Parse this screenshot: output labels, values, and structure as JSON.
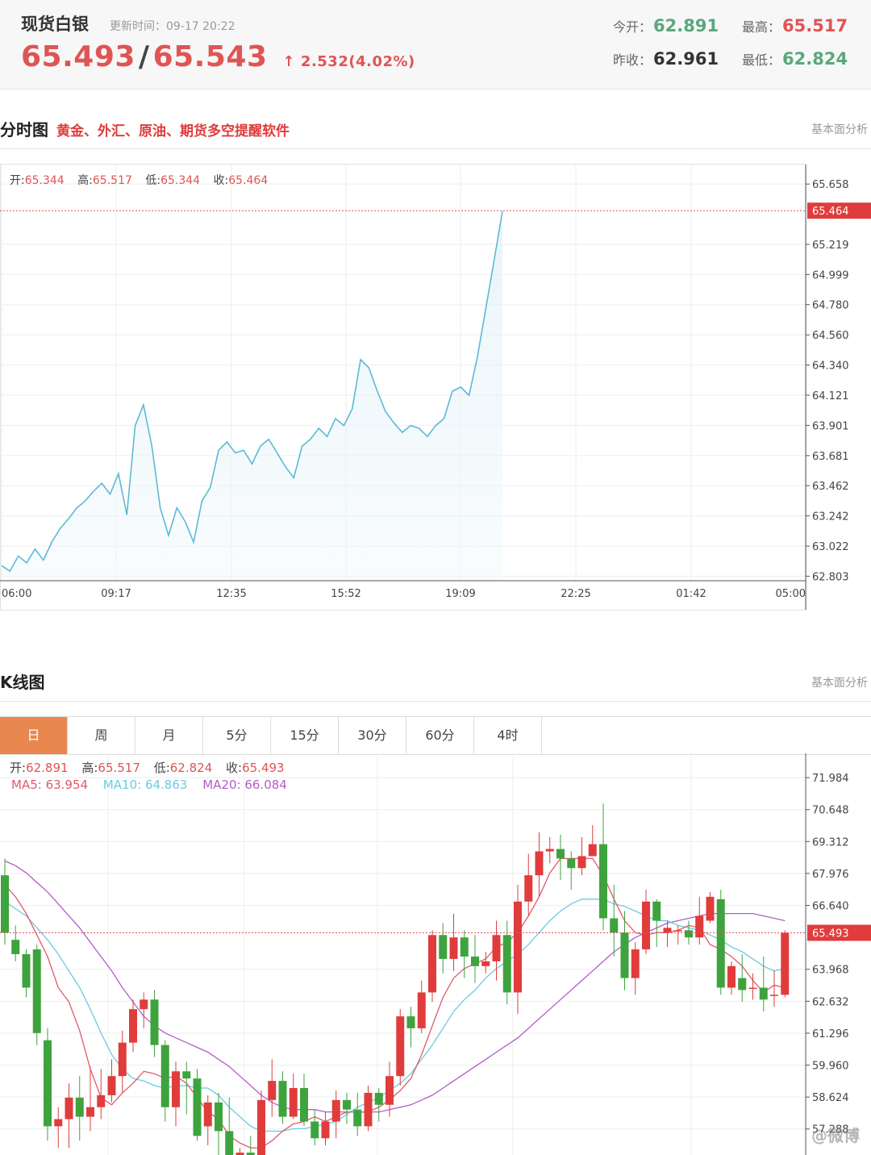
{
  "header": {
    "name": "现货白银",
    "update_time": "更新时间：09-17 20:22",
    "bid": "65.493",
    "ask": "65.543",
    "change": "2.532(4.02%)",
    "open_label": "今开：",
    "open": "62.891",
    "high_label": "最高：",
    "high": "65.517",
    "prev_close_label": "昨收：",
    "prev_close": "62.961",
    "low_label": "最低：",
    "low": "62.824"
  },
  "intraday_section": {
    "title": "分时图",
    "subtitle": "黄金、外汇、原油、期货多空提醒软件",
    "right_link": "基本面分析",
    "ohlc": {
      "o_label": "开:",
      "o": "65.344",
      "h_label": "高:",
      "h": "65.517",
      "l_label": "低:",
      "l": "65.344",
      "c_label": "收:",
      "c": "65.464"
    }
  },
  "kline_section": {
    "title": "K线图",
    "right_link": "基本面分析",
    "tabs": [
      "日",
      "周",
      "月",
      "5分",
      "15分",
      "30分",
      "60分",
      "4时"
    ],
    "active_tab": "日",
    "ohlc": {
      "o_label": "开:",
      "o": "62.891",
      "h_label": "高:",
      "h": "65.517",
      "l_label": "低:",
      "l": "62.824",
      "c_label": "收:",
      "c": "65.493"
    },
    "ma": {
      "ma5": "MA5: 63.954",
      "ma10": "MA10: 64.863",
      "ma20": "MA20: 66.084"
    }
  },
  "watermark": "@微博",
  "colors": {
    "up": "#e03c3c",
    "down": "#3ea33e",
    "line": "#5bbad5",
    "ma5": "#e05a6a",
    "ma10": "#6ccbe0",
    "ma20": "#b45cc8",
    "accent": "#e8874f"
  },
  "chart_data": [
    {
      "type": "line",
      "x_ticks": [
        "06:00",
        "09:17",
        "12:35",
        "15:52",
        "19:09",
        "22:25",
        "01:42",
        "05:00"
      ],
      "y_ticks": [
        "65.658",
        "65.219",
        "64.999",
        "64.780",
        "64.560",
        "64.340",
        "64.121",
        "63.901",
        "63.681",
        "63.462",
        "63.242",
        "63.022",
        "62.803"
      ],
      "ylim": [
        62.77,
        65.8
      ],
      "current_label": "65.464",
      "series": [
        {
          "values": [
            62.88,
            62.84,
            62.95,
            62.9,
            63.0,
            62.92,
            63.05,
            63.15,
            63.22,
            63.3,
            63.35,
            63.42,
            63.48,
            63.4,
            63.55,
            63.25,
            63.9,
            64.05,
            63.75,
            63.3,
            63.1,
            63.3,
            63.2,
            63.05,
            63.35,
            63.45,
            63.72,
            63.78,
            63.7,
            63.72,
            63.62,
            63.75,
            63.8,
            63.7,
            63.6,
            63.52,
            63.75,
            63.8,
            63.88,
            63.82,
            63.95,
            63.9,
            64.02,
            64.38,
            64.32,
            64.15,
            64.0,
            63.92,
            63.85,
            63.9,
            63.88,
            63.82,
            63.9,
            63.95,
            64.15,
            64.18,
            64.12,
            64.4,
            64.75,
            65.1,
            65.46
          ]
        }
      ]
    },
    {
      "type": "candlestick",
      "y_ticks": [
        "71.984",
        "70.648",
        "69.312",
        "67.976",
        "66.640",
        "65.493",
        "63.968",
        "62.632",
        "61.296",
        "59.960",
        "58.624",
        "57.288"
      ],
      "ylim": [
        56.2,
        73.0
      ],
      "current_label": "65.493",
      "candles": [
        [
          67.9,
          65.5,
          68.6,
          65.0
        ],
        [
          65.2,
          64.6,
          65.8,
          64.3
        ],
        [
          64.6,
          63.2,
          64.8,
          62.8
        ],
        [
          64.8,
          61.3,
          65.0,
          60.8
        ],
        [
          61.0,
          57.4,
          61.5,
          56.8
        ],
        [
          57.4,
          57.7,
          58.2,
          56.5
        ],
        [
          57.7,
          58.6,
          59.2,
          56.5
        ],
        [
          58.6,
          57.8,
          59.5,
          56.8
        ],
        [
          57.8,
          58.2,
          59.9,
          57.2
        ],
        [
          58.2,
          58.7,
          59.8,
          57.7
        ],
        [
          58.7,
          59.5,
          60.2,
          58.4
        ],
        [
          59.5,
          60.9,
          61.4,
          58.8
        ],
        [
          60.9,
          62.3,
          62.7,
          60.5
        ],
        [
          62.3,
          62.7,
          63.0,
          61.5
        ],
        [
          62.7,
          60.8,
          63.1,
          60.3
        ],
        [
          60.8,
          58.2,
          61.0,
          57.6
        ],
        [
          58.2,
          59.7,
          60.1,
          57.4
        ],
        [
          59.7,
          59.4,
          60.1,
          57.9
        ],
        [
          59.4,
          57.0,
          59.8,
          56.8
        ],
        [
          57.4,
          58.4,
          58.7,
          56.6
        ],
        [
          58.4,
          57.2,
          58.8,
          56.2
        ],
        [
          57.2,
          55.0,
          58.6,
          54.9
        ],
        [
          55.4,
          56.3,
          56.5,
          55.0
        ],
        [
          56.3,
          55.6,
          57.0,
          55.2
        ],
        [
          55.6,
          58.5,
          58.9,
          55.4
        ],
        [
          58.5,
          59.3,
          60.2,
          57.8
        ],
        [
          59.3,
          57.8,
          59.7,
          57.5
        ],
        [
          57.8,
          59.0,
          59.6,
          57.7
        ],
        [
          59.0,
          57.6,
          59.6,
          57.4
        ],
        [
          57.6,
          56.9,
          58.1,
          56.6
        ],
        [
          56.9,
          57.6,
          58.0,
          56.6
        ],
        [
          57.6,
          58.5,
          58.9,
          56.9
        ],
        [
          58.5,
          58.1,
          58.8,
          57.5
        ],
        [
          58.1,
          57.4,
          58.8,
          57.0
        ],
        [
          57.4,
          58.8,
          59.1,
          57.2
        ],
        [
          58.8,
          58.3,
          59.0,
          57.6
        ],
        [
          58.3,
          59.5,
          60.1,
          57.8
        ],
        [
          59.5,
          62.0,
          62.3,
          59.1
        ],
        [
          62.0,
          61.5,
          62.4,
          60.7
        ],
        [
          61.5,
          63.0,
          63.5,
          61.3
        ],
        [
          63.0,
          65.4,
          65.6,
          62.6
        ],
        [
          65.4,
          64.4,
          65.9,
          63.8
        ],
        [
          64.4,
          65.3,
          66.3,
          63.9
        ],
        [
          65.3,
          64.5,
          65.6,
          63.6
        ],
        [
          64.5,
          64.1,
          65.4,
          63.4
        ],
        [
          64.1,
          64.3,
          64.7,
          63.8
        ],
        [
          64.3,
          65.4,
          66.0,
          63.5
        ],
        [
          65.4,
          63.0,
          66.0,
          62.5
        ],
        [
          63.0,
          66.8,
          67.5,
          62.1
        ],
        [
          66.8,
          67.9,
          68.8,
          66.2
        ],
        [
          67.9,
          68.9,
          69.7,
          67.0
        ],
        [
          68.9,
          69.0,
          69.5,
          68.4
        ],
        [
          69.0,
          68.6,
          69.6,
          67.7
        ],
        [
          68.6,
          68.2,
          68.9,
          67.3
        ],
        [
          68.2,
          68.7,
          69.5,
          67.9
        ],
        [
          68.7,
          69.2,
          70.0,
          68.7
        ],
        [
          69.2,
          66.1,
          70.9,
          65.6
        ],
        [
          66.1,
          65.5,
          67.5,
          64.5
        ],
        [
          65.5,
          63.6,
          66.4,
          63.1
        ],
        [
          63.6,
          64.8,
          65.1,
          62.9
        ],
        [
          64.8,
          66.8,
          67.3,
          64.6
        ],
        [
          66.8,
          66.0,
          66.9,
          64.9
        ],
        [
          65.5,
          65.7,
          66.0,
          64.9
        ],
        [
          65.6,
          65.6,
          65.8,
          65.0
        ],
        [
          65.6,
          65.3,
          66.0,
          65.0
        ],
        [
          65.3,
          66.2,
          67.0,
          65.0
        ],
        [
          66.0,
          67.0,
          67.2,
          65.9
        ],
        [
          66.9,
          63.2,
          67.3,
          62.9
        ],
        [
          63.2,
          64.1,
          64.3,
          62.9
        ],
        [
          63.6,
          63.1,
          64.6,
          62.6
        ],
        [
          63.2,
          63.2,
          63.8,
          62.7
        ],
        [
          63.2,
          62.7,
          64.5,
          62.2
        ],
        [
          62.9,
          62.9,
          63.9,
          62.4
        ],
        [
          62.9,
          65.5,
          65.6,
          62.8
        ]
      ],
      "ma5": [
        67.5,
        67.0,
        66.3,
        65.4,
        64.5,
        63.2,
        62.6,
        61.4,
        59.8,
        58.6,
        58.3,
        58.8,
        59.2,
        59.7,
        59.6,
        59.4,
        59.5,
        59.2,
        58.6,
        58.0,
        57.7,
        57.0,
        56.7,
        56.5,
        56.5,
        56.8,
        57.2,
        57.5,
        57.6,
        57.8,
        57.6,
        57.8,
        58.0,
        58.0,
        58.0,
        58.2,
        58.5,
        58.9,
        59.4,
        60.4,
        61.6,
        62.8,
        63.6,
        64.0,
        64.2,
        64.4,
        64.9,
        65.1,
        65.5,
        66.2,
        67.0,
        68.0,
        68.6,
        68.6,
        68.6,
        68.6,
        67.9,
        66.9,
        66.0,
        65.5,
        65.4,
        65.5,
        65.5,
        65.6,
        65.8,
        65.7,
        65.0,
        64.8,
        64.5,
        64.1,
        63.5,
        63.0,
        63.3,
        63.2
      ],
      "ma10": [
        66.8,
        66.5,
        66.2,
        65.7,
        65.2,
        64.6,
        63.9,
        63.2,
        62.3,
        61.3,
        60.4,
        59.8,
        59.4,
        59.3,
        59.1,
        59.0,
        59.1,
        59.1,
        59.0,
        59.0,
        58.7,
        58.2,
        57.8,
        57.4,
        57.2,
        57.2,
        57.2,
        57.3,
        57.3,
        57.4,
        57.5,
        57.6,
        57.9,
        58.2,
        58.4,
        58.6,
        58.9,
        59.2,
        59.6,
        60.2,
        60.8,
        61.5,
        62.2,
        62.7,
        63.1,
        63.6,
        64.0,
        64.3,
        64.6,
        65.0,
        65.5,
        66.0,
        66.4,
        66.7,
        66.9,
        66.9,
        66.9,
        66.7,
        66.6,
        66.4,
        66.2,
        66.0,
        66.0,
        65.8,
        65.7,
        65.6,
        65.4,
        65.2,
        64.9,
        64.7,
        64.4,
        64.1,
        63.9,
        64.0
      ],
      "ma20": [
        68.5,
        68.3,
        68.0,
        67.6,
        67.2,
        66.7,
        66.2,
        65.7,
        65.1,
        64.5,
        63.9,
        63.2,
        62.6,
        62.0,
        61.6,
        61.3,
        61.1,
        60.9,
        60.7,
        60.5,
        60.2,
        59.9,
        59.5,
        59.1,
        58.7,
        58.4,
        58.2,
        58.1,
        58.1,
        58.1,
        58.0,
        58.0,
        58.0,
        58.0,
        58.0,
        58.0,
        58.1,
        58.2,
        58.3,
        58.5,
        58.7,
        59.0,
        59.3,
        59.6,
        59.9,
        60.2,
        60.5,
        60.8,
        61.1,
        61.5,
        61.9,
        62.3,
        62.7,
        63.1,
        63.5,
        63.9,
        64.3,
        64.7,
        65.0,
        65.3,
        65.5,
        65.7,
        65.9,
        66.0,
        66.1,
        66.2,
        66.3,
        66.3,
        66.3,
        66.3,
        66.3,
        66.2,
        66.1,
        66.0
      ]
    }
  ]
}
